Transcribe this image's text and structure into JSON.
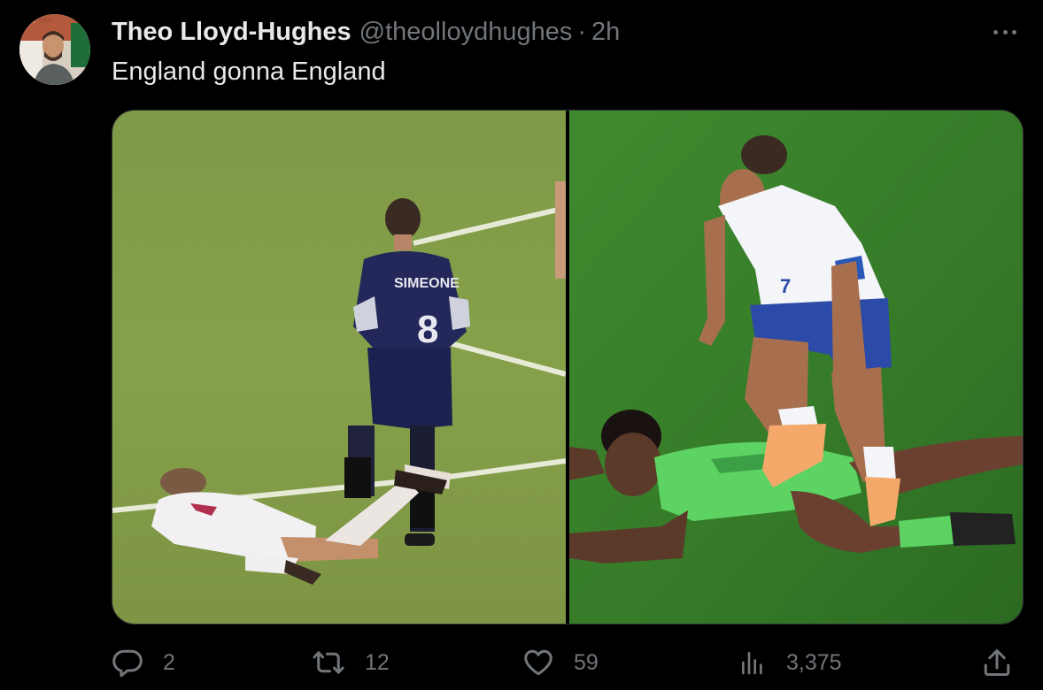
{
  "tweet": {
    "author": {
      "display_name": "Theo Lloyd-Hughes",
      "handle": "@theolloydhughes",
      "separator": "·",
      "time": "2h",
      "avatar_icon": "profile-photo"
    },
    "text": "England gonna England",
    "more_icon": "more-horizontal-icon",
    "media": {
      "left": {
        "description_icon": "photo-1998-match",
        "jersey_name": "SIMEONE",
        "jersey_number": "8"
      },
      "right": {
        "description_icon": "photo-2023-match",
        "jersey_number": "7"
      }
    },
    "stats": {
      "replies": "2",
      "retweets": "12",
      "likes": "59",
      "views": "3,375"
    }
  },
  "colors": {
    "background": "#000000",
    "text_primary": "#e7e9ea",
    "text_secondary": "#71767b",
    "border": "#2f3336"
  }
}
